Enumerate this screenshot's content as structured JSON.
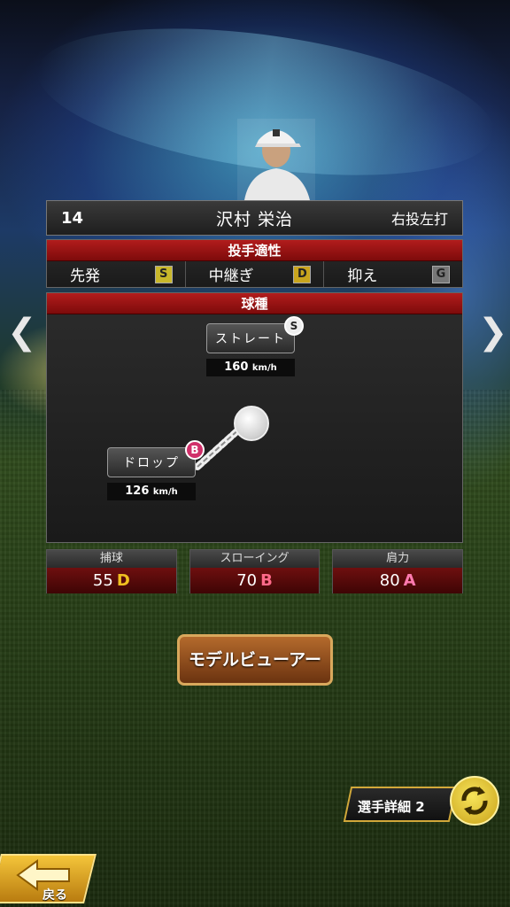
{
  "player": {
    "number": "14",
    "name": "沢村 栄治",
    "handedness": "右投左打"
  },
  "aptitude": {
    "title": "投手適性",
    "items": [
      {
        "label": "先発",
        "grade": "S"
      },
      {
        "label": "中継ぎ",
        "grade": "D"
      },
      {
        "label": "抑え",
        "grade": "G"
      }
    ]
  },
  "pitch_types": {
    "title": "球種",
    "items": [
      {
        "name": "ストレート",
        "speed": "160",
        "unit": "km/h",
        "grade": "S"
      },
      {
        "name": "ドロップ",
        "speed": "126",
        "unit": "km/h",
        "grade": "B"
      }
    ]
  },
  "stats": [
    {
      "label": "捕球",
      "value": "55",
      "rank": "D",
      "rank_color": "#f0c020"
    },
    {
      "label": "スローイング",
      "value": "70",
      "rank": "B",
      "rank_color": "#ff6a8a"
    },
    {
      "label": "肩力",
      "value": "80",
      "rank": "A",
      "rank_color": "#ff7ab0"
    }
  ],
  "buttons": {
    "model_viewer": "モデルビューアー",
    "detail": "選手詳細 2",
    "back": "戻る"
  },
  "nav": {
    "prev": "❮",
    "next": "❯"
  },
  "colors": {
    "header_red": "#b21c1c",
    "grade_s": "#c9b82a",
    "grade_d": "#c9a51d",
    "grade_g": "#777777",
    "badge_s": "#eeeeee",
    "badge_b": "#d0306a"
  }
}
